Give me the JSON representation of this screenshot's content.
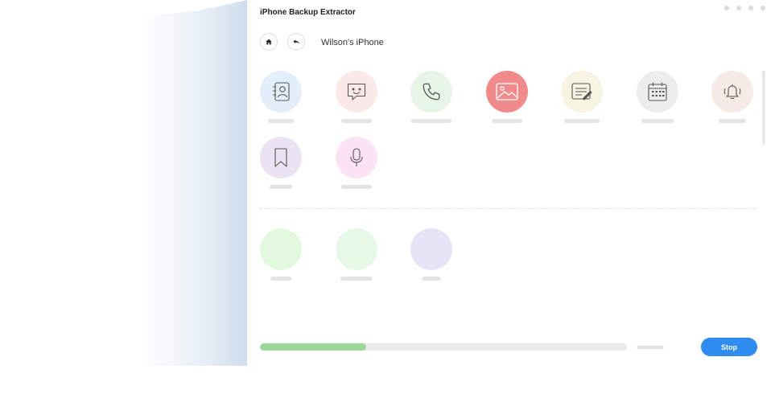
{
  "app": {
    "title": "iPhone Backup Extractor"
  },
  "header": {
    "device_name": "Wilson's iPhone",
    "home_icon": "home-icon",
    "back_icon": "back-arrow-icon"
  },
  "categories": [
    {
      "icon": "contacts-icon",
      "bg": "#e4eefb"
    },
    {
      "icon": "messages-icon",
      "bg": "#fbe9e9"
    },
    {
      "icon": "phone-icon",
      "bg": "#e6f5e6"
    },
    {
      "icon": "photos-icon",
      "bg": "#f18a8a"
    },
    {
      "icon": "notes-icon",
      "bg": "#f7f4e2"
    },
    {
      "icon": "calendar-icon",
      "bg": "#ededed"
    },
    {
      "icon": "reminders-icon",
      "bg": "#f6ebe4"
    },
    {
      "icon": "bookmarks-icon",
      "bg": "#ebe3f3"
    },
    {
      "icon": "voice-memos-icon",
      "bg": "#fbe3f5"
    }
  ],
  "app_categories": [
    {
      "bg": "#e3f9df"
    },
    {
      "bg": "#e6f9e6"
    },
    {
      "bg": "#e6e3f7"
    }
  ],
  "progress": {
    "percent": 29
  },
  "actions": {
    "stop_label": "Stop"
  },
  "colors": {
    "accent": "#2f8cf0",
    "progress": "#9dd89a"
  }
}
